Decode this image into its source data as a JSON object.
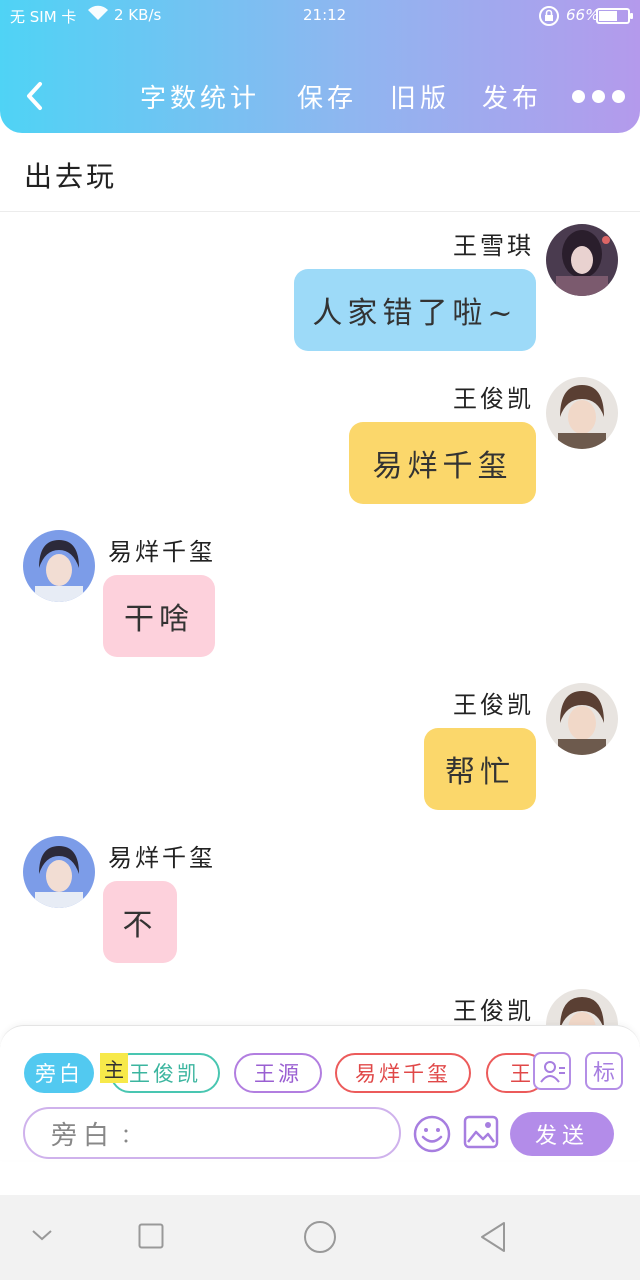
{
  "status_bar": {
    "carrier": "无 SIM 卡",
    "speed": "2 KB/s",
    "time": "21:12",
    "battery_pct": "66%",
    "battery_level": 0.66
  },
  "header": {
    "back_icon": "chevron-left-icon",
    "items": [
      "字数统计",
      "保存",
      "旧版",
      "发布"
    ],
    "more_icon": "more-dots-icon"
  },
  "title": "出去玩",
  "messages": [
    {
      "side": "right",
      "sender": "王雪琪",
      "text": "人家错了啦~",
      "color": "#9ddaf8"
    },
    {
      "side": "right",
      "sender": "王俊凯",
      "text": "易烊千玺",
      "color": "#fbd76b"
    },
    {
      "side": "left",
      "sender": "易烊千玺",
      "text": "干啥",
      "color": "#fdd1dc"
    },
    {
      "side": "right",
      "sender": "王俊凯",
      "text": "帮忙",
      "color": "#fbd76b"
    },
    {
      "side": "left",
      "sender": "易烊千玺",
      "text": "不",
      "color": "#fdd1dc"
    },
    {
      "side": "right",
      "sender": "王俊凯",
      "text": "",
      "color": "#fbd76b"
    }
  ],
  "composer": {
    "chips": [
      "旁白",
      "王俊凯",
      "王源",
      "易烊千玺",
      "王"
    ],
    "main_tag": "主",
    "mark_label": "标",
    "input_prefix": "旁白",
    "input_colon": "：",
    "send_label": "发送"
  },
  "colors": {
    "header_start": "#4fd3f5",
    "header_end": "#b49aec",
    "accent_purple": "#b38ce9",
    "chip_narration": "#52c9f0"
  }
}
